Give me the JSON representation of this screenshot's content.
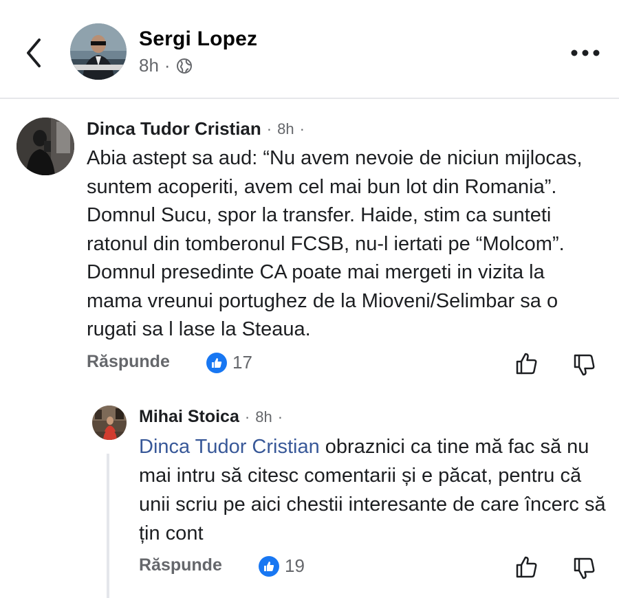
{
  "post": {
    "author": "Sergi Lopez",
    "time": "8h",
    "separator": "·"
  },
  "comments": [
    {
      "author": "Dinca Tudor Cristian",
      "time": "8h",
      "text": "Abia astept sa aud: “Nu avem nevoie de niciun mijlocas, suntem acoperiti, avem cel mai bun lot din Romania”. Domnul Sucu, spor la transfer. Haide, stim ca sunteti ratonul din tomberonul FCSB, nu-l iertati pe “Molcom”. Domnul presedinte CA poate mai mergeti in vizita la mama vreunui portughez de la Mioveni/Selimbar sa o rugati sa l lase la Steaua.",
      "reply_label": "Răspunde",
      "likes": "17"
    },
    {
      "author": "Mihai Stoica",
      "time": "8h",
      "mention": "Dinca Tudor Cristian",
      "text": " obraznici ca tine mă fac să nu mai intru să citesc comentarii și e păcat, pentru că unii scriu pe aici chestii interesante de care încerc să țin cont",
      "reply_label": "Răspunde",
      "likes": "19"
    }
  ],
  "colors": {
    "like_blue": "#1877f2",
    "mention_blue": "#385898",
    "meta_gray": "#65676b"
  },
  "icons": [
    "back-chevron-icon",
    "globe-icon",
    "more-options-icon",
    "like-reaction-icon",
    "thumbs-up-icon",
    "thumbs-down-icon"
  ]
}
